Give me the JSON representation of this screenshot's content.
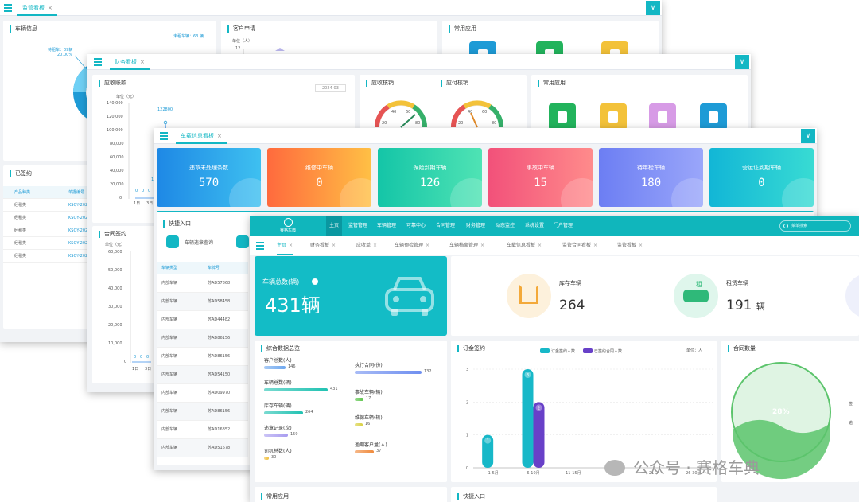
{
  "win1": {
    "tab": "监管看板",
    "tab_close": "×",
    "corner": "∨",
    "vehicle_info": {
      "title": "车辆信息",
      "total_label": "未租车辆：63 辆",
      "pie_label": "待租车：09辆",
      "pie_pct": "20.00%"
    },
    "customer": {
      "title": "客户申请",
      "unit": "单位（人）",
      "y_top": "12"
    },
    "apps_title": "常用应用",
    "signed": {
      "title": "已签约",
      "headers": [
        "产品种类",
        "单据编号"
      ],
      "rows": [
        [
          "经租类",
          "KSQY-202"
        ],
        [
          "经租类",
          "KSQY-202"
        ],
        [
          "经租类",
          "KSQY-202"
        ],
        [
          "经租类",
          "KSQY-202"
        ],
        [
          "经租类",
          "KSQY-202"
        ]
      ]
    }
  },
  "win2": {
    "tab": "财务看板",
    "tab_close": "×",
    "corner": "∨",
    "receivable": {
      "title": "应收账款",
      "date": "2024-03",
      "unit": "单位（元）",
      "y_ticks": [
        "140,000",
        "120,000",
        "100,000",
        "80,000",
        "60,000",
        "40,000",
        "20,000",
        "0"
      ],
      "peak_label": "122800",
      "side_label": "10",
      "zero_labels": [
        "0",
        "0",
        "0"
      ],
      "x_ticks": [
        "1日",
        "3日"
      ]
    },
    "gauge1": {
      "title": "应收核销",
      "ticks": [
        "20",
        "40",
        "60",
        "80"
      ]
    },
    "gauge2": {
      "title": "应付核销",
      "ticks": [
        "20",
        "40",
        "60",
        "80"
      ]
    },
    "apps_title": "常用应用",
    "contract": {
      "title": "合同签约",
      "unit": "单位（元）",
      "y_ticks": [
        "60,000",
        "50,000",
        "40,000",
        "30,000",
        "20,000",
        "10,000",
        "0"
      ],
      "zero_labels": [
        "0",
        "0",
        "0"
      ],
      "x_ticks": [
        "1日",
        "3日"
      ]
    }
  },
  "win3": {
    "tab": "车载信息看板",
    "tab_close": "×",
    "corner": "∨",
    "stats": [
      {
        "label": "违章未处理条数",
        "value": "570",
        "c1": "#1e88e5",
        "c2": "#3ec0f0"
      },
      {
        "label": "维修中车辆",
        "value": "0",
        "c1": "#ff6a3d",
        "c2": "#ffc045"
      },
      {
        "label": "保险到期车辆",
        "value": "126",
        "c1": "#14c5a7",
        "c2": "#4fe3b4"
      },
      {
        "label": "事故中车辆",
        "value": "15",
        "c1": "#f2517a",
        "c2": "#ff8b8b"
      },
      {
        "label": "待年检车辆",
        "value": "180",
        "c1": "#6c7ef3",
        "c2": "#9aa6fa"
      },
      {
        "label": "营运证到期车辆",
        "value": "0",
        "c1": "#12b6d6",
        "c2": "#38dbd3"
      }
    ],
    "quick": {
      "title": "快捷入口",
      "item1": "车辆违章查询"
    },
    "table": {
      "headers": [
        "车辆类型",
        "车牌号"
      ],
      "rows": [
        [
          "内部车辆",
          "苏AD57868"
        ],
        [
          "内部车辆",
          "苏AD58458"
        ],
        [
          "内部车辆",
          "苏AD44482"
        ],
        [
          "内部车辆",
          "苏AD86156"
        ],
        [
          "内部车辆",
          "苏AD86156"
        ],
        [
          "内部车辆",
          "苏AD54150"
        ],
        [
          "内部车辆",
          "苏AD09970"
        ],
        [
          "内部车辆",
          "苏AD86156"
        ],
        [
          "内部车辆",
          "苏AD16852"
        ],
        [
          "内部车辆",
          "苏AD51678"
        ]
      ]
    }
  },
  "win4": {
    "logo": "赛格车典",
    "nav": [
      "主页",
      "监管管理",
      "车辆管理",
      "可靠中心",
      "合同管理",
      "财务管理",
      "动态监控",
      "系统设置",
      "门户管理"
    ],
    "search": "菜单搜索",
    "tabs": [
      "主页",
      "财务看板",
      "应收单",
      "车辆预检管理",
      "车辆档案管理",
      "车载信息看板",
      "监管合同看板",
      "监管看板"
    ],
    "close": "×",
    "total": {
      "label": "车辆总数(辆)",
      "value": "431辆"
    },
    "stock": {
      "label": "库存车辆",
      "value": "264"
    },
    "rent": {
      "label": "租赁车辆",
      "value": "191",
      "unit": "辆",
      "icon_text": "租"
    },
    "overview": {
      "title": "综合数据总览",
      "left": [
        {
          "label": "客户总数(人)",
          "value": "146",
          "pct": 0.34,
          "color": "#6fa8ef"
        },
        {
          "label": "车辆总数(辆)",
          "value": "431",
          "pct": 1.0,
          "color": "#21c2b2"
        },
        {
          "label": "库存车辆(辆)",
          "value": "264",
          "pct": 0.61,
          "color": "#21c2b2"
        },
        {
          "label": "违章记录(次)",
          "value": "159",
          "pct": 0.37,
          "color": "#a89cf0"
        },
        {
          "label": "司机总数(人)",
          "value": "30",
          "pct": 0.07,
          "color": "#f0c040"
        }
      ],
      "right": [
        {
          "label": "执行合同(份)",
          "value": "132",
          "pct": 1.0,
          "color": "#6f8ff0"
        },
        {
          "label": "事故车辆(辆)",
          "value": "17",
          "pct": 0.13,
          "color": "#5bc44a"
        },
        {
          "label": "维保车辆(辆)",
          "value": "16",
          "pct": 0.12,
          "color": "#d8d040"
        },
        {
          "label": "逾期客户量(人)",
          "value": "37",
          "pct": 0.28,
          "color": "#f08a3c"
        }
      ]
    },
    "orders": {
      "title": "订金签约",
      "legend1": "订金签约人数",
      "legend2": "已签约合同人数",
      "unit": "单位：人"
    },
    "contracts": {
      "title": "合同数量",
      "pct": "28%",
      "side1": "签",
      "side2": "逾"
    },
    "bottom1": "常用应用",
    "bottom2": "快捷入口"
  },
  "chart_data": {
    "type": "bar",
    "title": "订金签约",
    "categories": [
      "1-5月",
      "6-10月",
      "11-15月",
      "16-20月",
      "21-25月",
      "26-30月"
    ],
    "x_tick_labels": [
      "1-5月",
      "6-10月",
      "11-15月",
      "16-2",
      "21-2",
      "26-30月"
    ],
    "series": [
      {
        "name": "订金签约人数",
        "values": [
          1,
          3,
          0,
          0,
          0,
          0
        ],
        "color": "#17b8c8"
      },
      {
        "name": "已签约合同人数",
        "values": [
          0,
          2,
          0,
          0,
          0,
          0
        ],
        "color": "#6840c8"
      }
    ],
    "ylim": [
      0,
      3
    ],
    "y_ticks": [
      "0",
      "1",
      "2",
      "3"
    ],
    "grid": true,
    "legend": "top"
  },
  "watermark": "公众号 · 赛格车典"
}
